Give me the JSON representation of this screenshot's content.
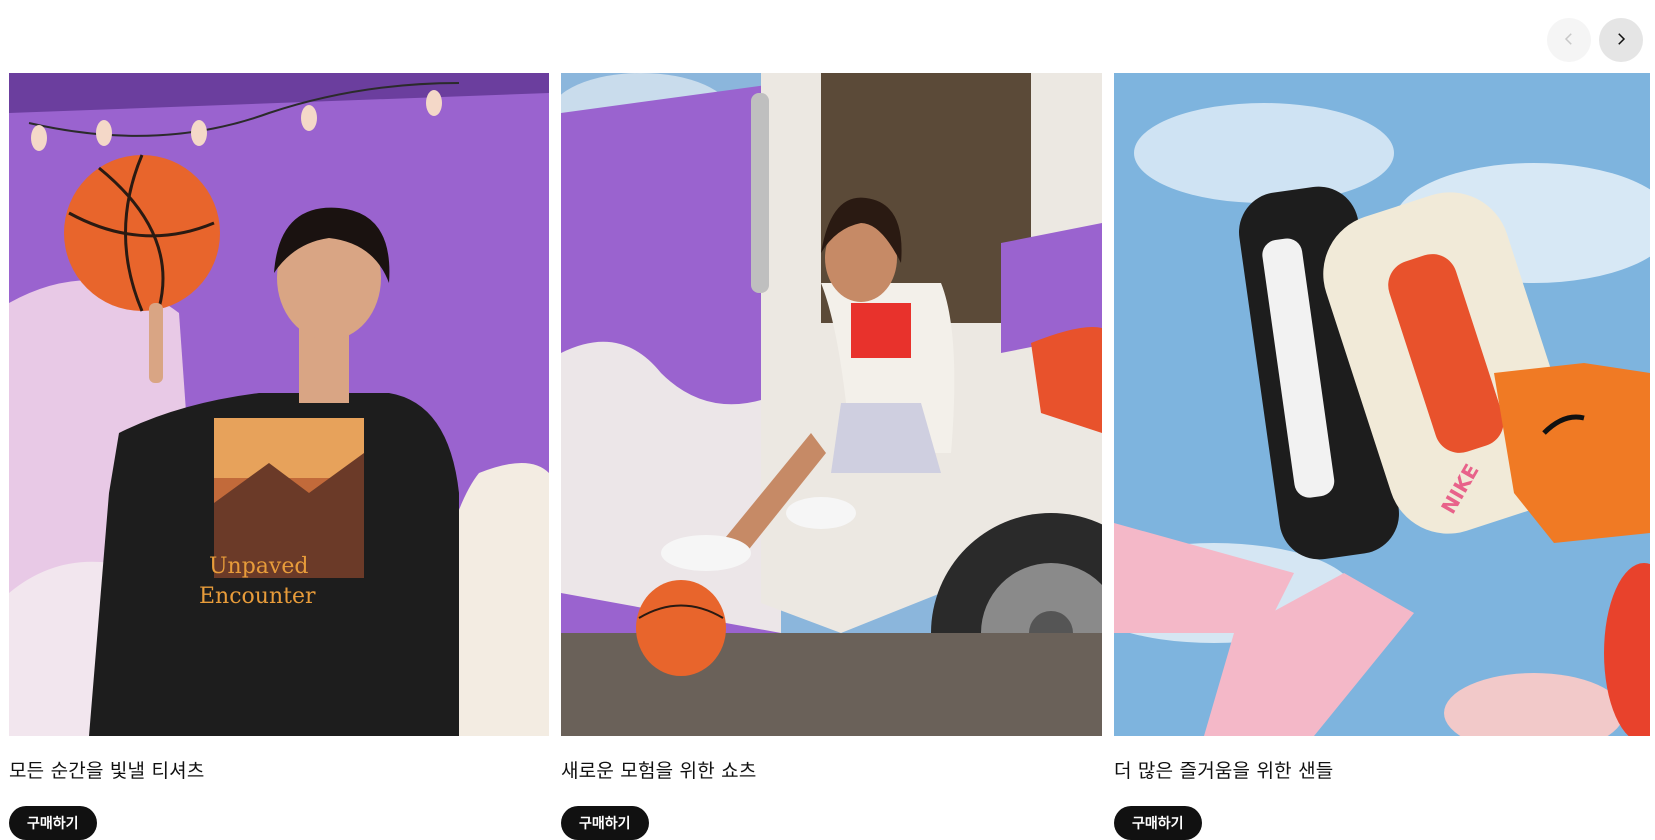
{
  "carousel": {
    "prev_icon": "chevron-left-icon",
    "next_icon": "chevron-right-icon",
    "cards": [
      {
        "title": "모든 순간을 빛낼 티셔츠",
        "shop_label": "구매하기",
        "image": "man-spinning-basketball-purple-truck",
        "tshirt_text_line1": "Unpaved",
        "tshirt_text_line2": "Encounter"
      },
      {
        "title": "새로운 모험을 위한 쇼츠",
        "shop_label": "구매하기",
        "image": "woman-sitting-in-truck-door-basketball"
      },
      {
        "title": "더 많은 즐거움을 위한 샌들",
        "shop_label": "구매하기",
        "image": "feet-in-sandals-against-sky",
        "sandal_text": "NIKE"
      }
    ]
  },
  "colors": {
    "button_bg": "#111111",
    "button_text": "#ffffff",
    "truck_purple": "#9a63cf",
    "ball_orange": "#e8652c"
  }
}
